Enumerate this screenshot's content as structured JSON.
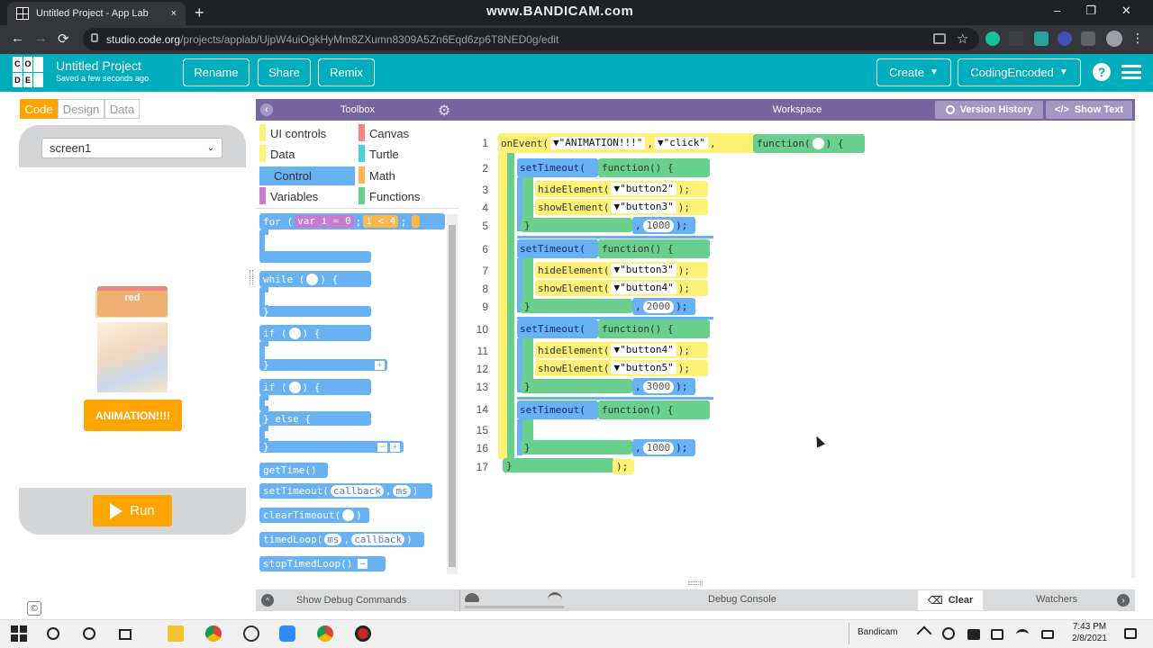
{
  "browser": {
    "tab_title": "Untitled Project - App Lab",
    "tab_close": "×",
    "new_tab": "+",
    "watermark": "www.BANDICAM.com",
    "window_controls": [
      "–",
      "❐",
      "✕"
    ],
    "url_host": "studio.code.org",
    "url_path": "/projects/applab/UjpW4uiOgkHyMm8ZXumn8309A5Zn6Eqd6zp6T8NED0g/edit",
    "nav": {
      "back": "←",
      "forward": "→",
      "reload": "⟳"
    }
  },
  "header": {
    "logo_letters": [
      "C",
      "O",
      "D",
      "E",
      "",
      ""
    ],
    "project_title": "Untitled Project",
    "saved_status": "Saved a few seconds ago",
    "buttons": [
      "Rename",
      "Share",
      "Remix"
    ],
    "create_label": "Create",
    "user_label": "CodingEncoded",
    "dropdown_glyph": "▼",
    "help_glyph": "?"
  },
  "modes": [
    "Code",
    "Design",
    "Data"
  ],
  "app": {
    "screen_select": "screen1",
    "select_caret": "⌄",
    "red_label": "red",
    "anim_button": "ANIMATION!!!!",
    "run_label": "Run",
    "copyright": "©"
  },
  "toolbox": {
    "title": "Toolbox",
    "collapse_glyph": "‹",
    "gear_glyph": "⚙",
    "categories": [
      {
        "name": "UI controls",
        "color": "#fff176"
      },
      {
        "name": "Canvas",
        "color": "#f78183"
      },
      {
        "name": "Data",
        "color": "#fff176"
      },
      {
        "name": "Turtle",
        "color": "#4dd0e1"
      },
      {
        "name": "Control",
        "color": "#68b1f2"
      },
      {
        "name": "Math",
        "color": "#ffb74d"
      },
      {
        "name": "Variables",
        "color": "#c77bce"
      },
      {
        "name": "Functions",
        "color": "#68d08c"
      }
    ],
    "blocks": {
      "for_kw": "for (",
      "for_var": "var i = 0",
      "for_semi": ";",
      "for_cond": "i < 4",
      "while_kw": "while (",
      "if_kw": "if (",
      "block_open": ") {",
      "block_close": "}",
      "else_kw": "} else {",
      "get_time": "getTime()",
      "set_timeout": "setTimeout(",
      "callback": "callback",
      "ms": "ms",
      "comma": ",",
      "close_paren": ")",
      "clear_timeout": "clearTimeout(",
      "timed_loop": "timedLoop(",
      "stop_timed_loop": "stopTimedLoop()",
      "plus_glyph": "+",
      "minus_glyph": "–",
      "arrow_glyph": "→"
    }
  },
  "workspace": {
    "title": "Workspace",
    "version_history": "Version History",
    "show_text": "Show Text",
    "line_numbers": [
      "1",
      "2",
      "3",
      "4",
      "5",
      "6",
      "7",
      "8",
      "9",
      "10",
      "11",
      "12",
      "13",
      "14",
      "15",
      "16",
      "17"
    ],
    "on_event": "onEvent(",
    "event_target": "\"ANIMATION!!!\"",
    "event_type": "\"click\"",
    "dropdown": "▼",
    "function_kw": "function(",
    "function_empty": "function() {",
    "open_brace": ") {",
    "set_timeout": "setTimeout(",
    "hide_element": "hideElement(",
    "show_element": "showElement(",
    "stmt_end": ");",
    "comma": ",",
    "close_brace": "}",
    "timeouts": [
      {
        "hide": "\"button2\"",
        "show": "\"button3\"",
        "delay": "1000"
      },
      {
        "hide": "\"button3\"",
        "show": "\"button4\"",
        "delay": "2000"
      },
      {
        "hide": "\"button4\"",
        "show": "\"button5\"",
        "delay": "3000"
      },
      {
        "delay": "1000"
      }
    ]
  },
  "debug": {
    "show_commands": "Show Debug Commands",
    "console": "Debug Console",
    "clear": "Clear",
    "watchers": "Watchers",
    "toggle_glyph": "^",
    "watchers_glyph": "›"
  },
  "taskbar": {
    "tray_app": "Bandicam",
    "time": "7:43 PM",
    "date": "2/8/2021"
  }
}
